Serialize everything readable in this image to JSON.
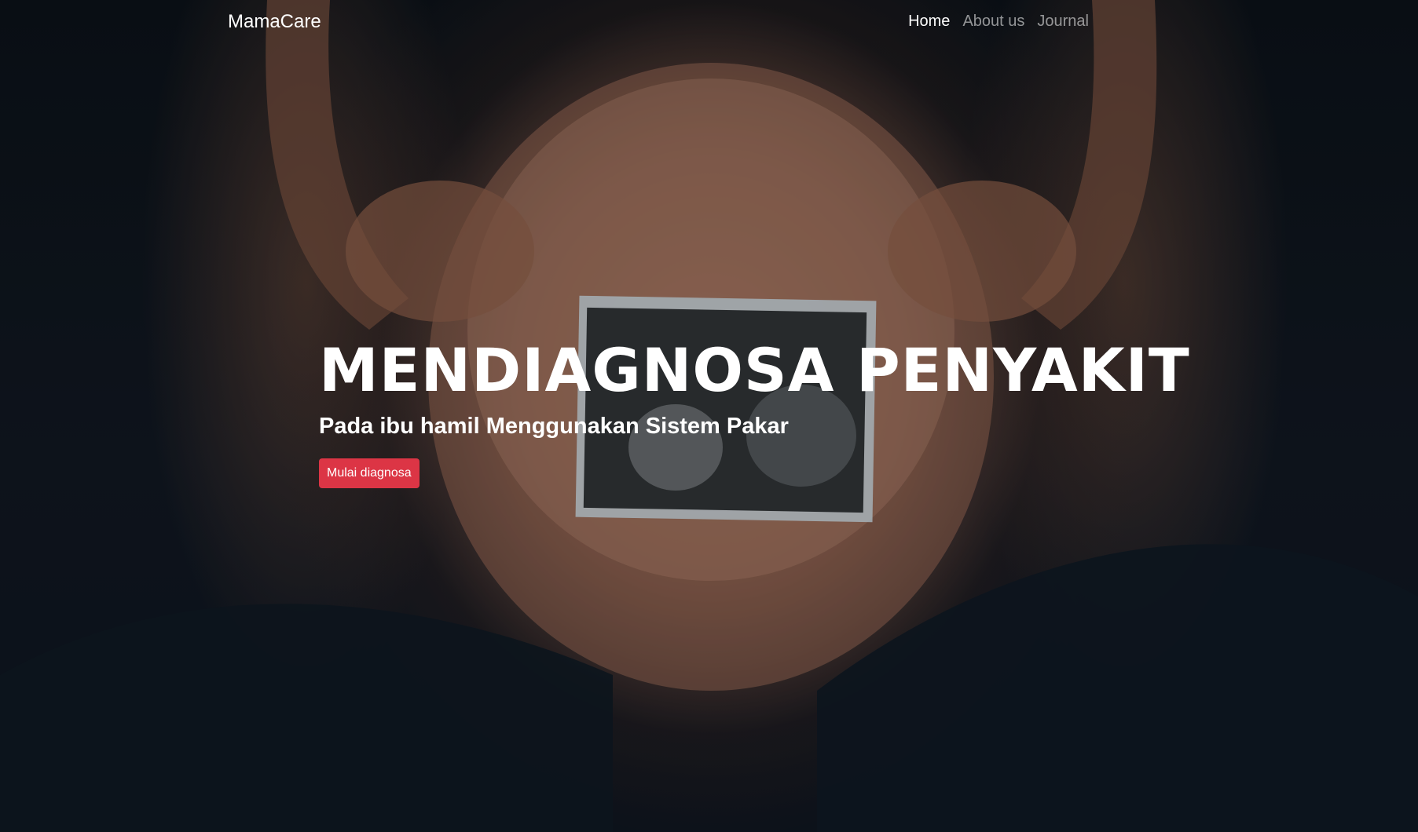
{
  "app": {
    "brand": "MamaCare"
  },
  "nav": {
    "items": [
      {
        "label": "Home",
        "active": true
      },
      {
        "label": "About us",
        "active": false
      },
      {
        "label": "Journal",
        "active": false
      }
    ]
  },
  "hero": {
    "title": "MENDIAGNOSA PENYAKIT",
    "subtitle": "Pada ibu hamil Menggunakan Sistem Pakar",
    "cta_label": "Mulai diagnosa",
    "background_image": "pregnant-belly-holding-ultrasound-photo"
  },
  "colors": {
    "accent": "#dc3545",
    "text": "#ffffff",
    "nav_inactive": "rgba(255,255,255,0.55)",
    "background": "#0b0f16"
  }
}
